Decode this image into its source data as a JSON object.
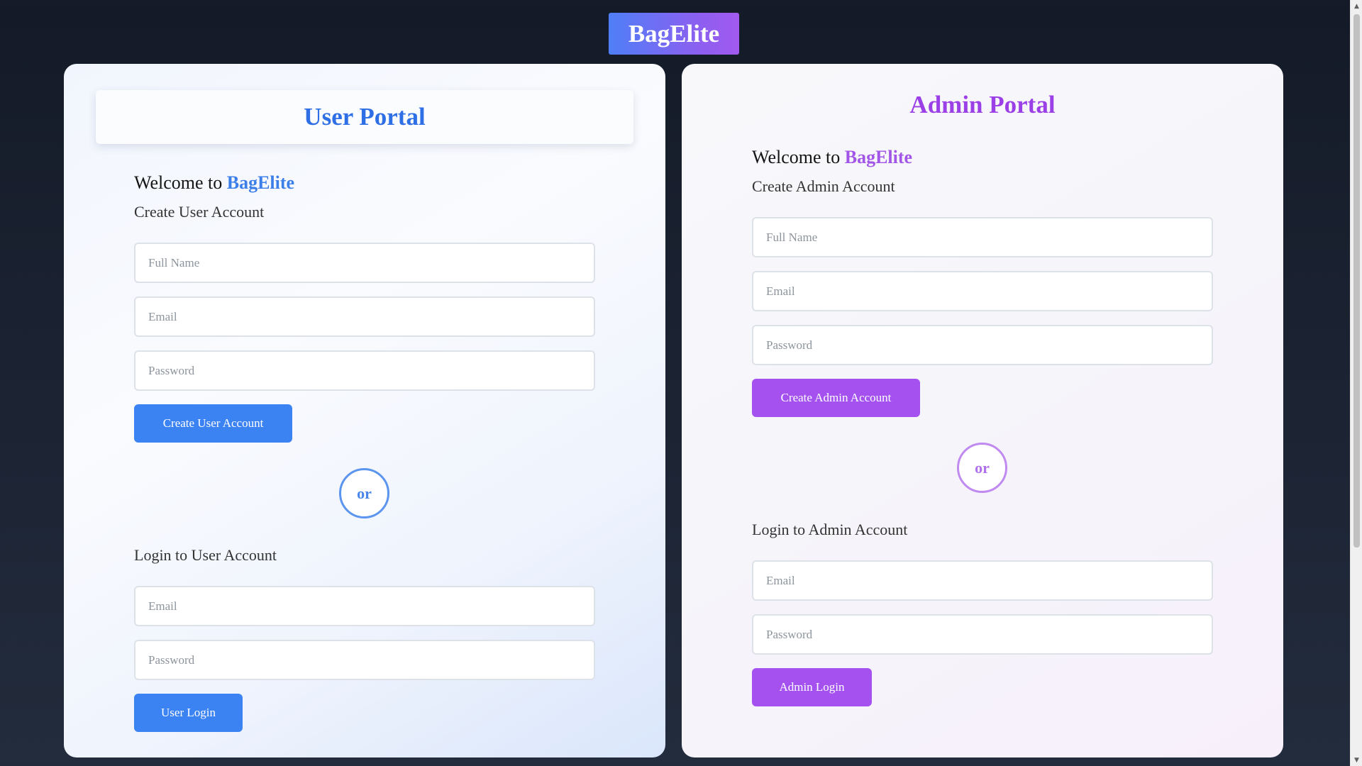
{
  "brand": {
    "name": "BagElite"
  },
  "user_portal": {
    "title": "User Portal",
    "welcome_prefix": "Welcome to",
    "welcome_brand": "BagElite",
    "create_heading": "Create User Account",
    "create_fields": {
      "full_name_placeholder": "Full Name",
      "email_placeholder": "Email",
      "password_placeholder": "Password"
    },
    "create_button": "Create User Account",
    "or_label": "or",
    "login_heading": "Login to User Account",
    "login_fields": {
      "email_placeholder": "Email",
      "password_placeholder": "Password"
    },
    "login_button": "User Login"
  },
  "admin_portal": {
    "title": "Admin Portal",
    "welcome_prefix": "Welcome to",
    "welcome_brand": "BagElite",
    "create_heading": "Create Admin Account",
    "create_fields": {
      "full_name_placeholder": "Full Name",
      "email_placeholder": "Email",
      "password_placeholder": "Password"
    },
    "create_button": "Create Admin Account",
    "or_label": "or",
    "login_heading": "Login to Admin Account",
    "login_fields": {
      "email_placeholder": "Email",
      "password_placeholder": "Password"
    },
    "login_button": "Admin Login"
  },
  "colors": {
    "user_accent": "#3b82f2",
    "admin_accent": "#a451f0",
    "page_background": "#1a2130"
  }
}
